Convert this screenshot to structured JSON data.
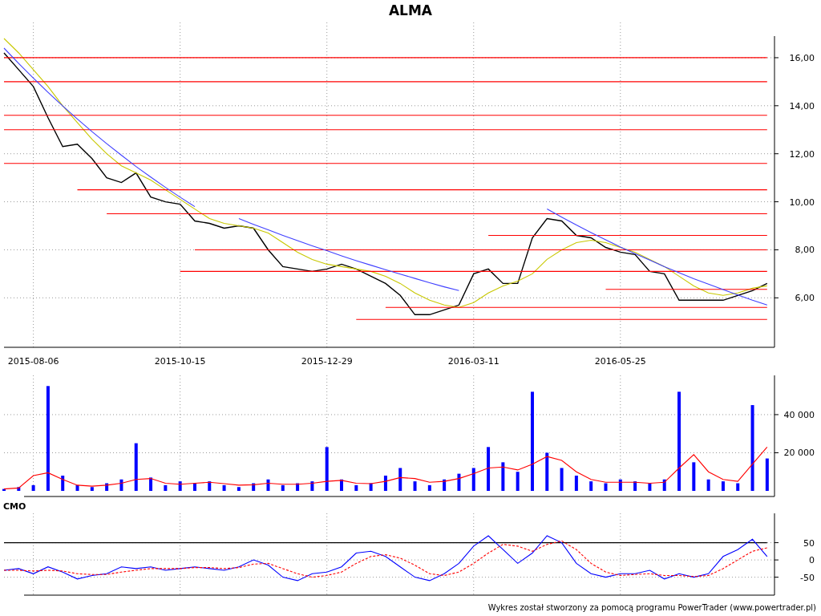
{
  "title": "ALMA",
  "price_panel": {
    "chart_data": {
      "type": "line",
      "grid": true,
      "categories": [
        null,
        null,
        "2015-08-06",
        null,
        null,
        null,
        null,
        null,
        null,
        null,
        null,
        null,
        "2015-10-15",
        null,
        null,
        null,
        null,
        null,
        null,
        null,
        null,
        null,
        "2015-12-29",
        null,
        null,
        null,
        null,
        null,
        null,
        null,
        null,
        null,
        "2016-03-11",
        null,
        null,
        null,
        null,
        null,
        null,
        null,
        null,
        null,
        "2016-05-25",
        null,
        null,
        null,
        null,
        null,
        null,
        null,
        null,
        null,
        null
      ],
      "series": [
        {
          "color": "#000000",
          "values": [
            16.2,
            15.5,
            14.8,
            13.5,
            12.3,
            12.4,
            11.8,
            11,
            10.8,
            11.2,
            10.2,
            10,
            9.9,
            9.2,
            9.1,
            8.9,
            9,
            8.9,
            8,
            7.3,
            7.2,
            7.1,
            7.2,
            7.4,
            7.2,
            6.9,
            6.6,
            6.1,
            5.3,
            5.3,
            5.5,
            5.7,
            7,
            7.2,
            6.6,
            6.6,
            8.5,
            9.3,
            9.2,
            8.6,
            8.5,
            8.1,
            7.9,
            7.8,
            7.1,
            7,
            5.9,
            5.9,
            5.9,
            5.9,
            6.1,
            6.3,
            6.6
          ]
        },
        {
          "color": "#c8c800",
          "values": [
            16.8,
            16.2,
            15.5,
            14.8,
            14,
            13.3,
            12.6,
            12,
            11.5,
            11.2,
            10.9,
            10.5,
            10.1,
            9.7,
            9.3,
            9.1,
            9,
            8.9,
            8.7,
            8.3,
            7.9,
            7.6,
            7.4,
            7.3,
            7.2,
            7.1,
            6.9,
            6.6,
            6.2,
            5.9,
            5.7,
            5.6,
            5.8,
            6.2,
            6.5,
            6.7,
            7,
            7.6,
            8,
            8.3,
            8.4,
            8.3,
            8.1,
            7.9,
            7.6,
            7.3,
            6.9,
            6.5,
            6.2,
            6.1,
            6.2,
            6.4,
            6.5
          ]
        },
        {
          "color": "#ff0000",
          "values": [
            16,
            16,
            16,
            16,
            16,
            16,
            16,
            16,
            16,
            16,
            16,
            16,
            16,
            16,
            16,
            16,
            16,
            16,
            16,
            16,
            16,
            16,
            16,
            16,
            16,
            16,
            16,
            16,
            16,
            16,
            16,
            16,
            16,
            16,
            16,
            16,
            16,
            16,
            16,
            16,
            16,
            16,
            16,
            16,
            16,
            16,
            16,
            16,
            16,
            16,
            16,
            16,
            16
          ]
        },
        {
          "color": "#ff0000",
          "values": [
            15,
            15,
            15,
            15,
            15,
            15,
            15,
            15,
            15,
            15,
            15,
            15,
            15,
            15,
            15,
            15,
            15,
            15,
            15,
            15,
            15,
            15,
            15,
            15,
            15,
            15,
            15,
            15,
            15,
            15,
            15,
            15,
            15,
            15,
            15,
            15,
            15,
            15,
            15,
            15,
            15,
            15,
            15,
            15,
            15,
            15,
            15,
            15,
            15,
            15,
            15,
            15,
            15
          ]
        },
        {
          "color": "#ff0000",
          "values": [
            13.6,
            13.6,
            13.6,
            13.6,
            13.6,
            13.6,
            13.6,
            13.6,
            13.6,
            13.6,
            13.6,
            13.6,
            13.6,
            13.6,
            13.6,
            13.6,
            13.6,
            13.6,
            13.6,
            13.6,
            13.6,
            13.6,
            13.6,
            13.6,
            13.6,
            13.6,
            13.6,
            13.6,
            13.6,
            13.6,
            13.6,
            13.6,
            13.6,
            13.6,
            13.6,
            13.6,
            13.6,
            13.6,
            13.6,
            13.6,
            13.6,
            13.6,
            13.6,
            13.6,
            13.6,
            13.6,
            13.6,
            13.6,
            13.6,
            13.6,
            13.6,
            13.6,
            13.6
          ]
        },
        {
          "color": "#ff0000",
          "values": [
            13,
            13,
            13,
            13,
            13,
            13,
            13,
            13,
            13,
            13,
            13,
            13,
            13,
            13,
            13,
            13,
            13,
            13,
            13,
            13,
            13,
            13,
            13,
            13,
            13,
            13,
            13,
            13,
            13,
            13,
            13,
            13,
            13,
            13,
            13,
            13,
            13,
            13,
            13,
            13,
            13,
            13,
            13,
            13,
            13,
            13,
            13,
            13,
            13,
            13,
            13,
            13,
            13
          ]
        },
        {
          "color": "#ff0000",
          "values": [
            11.6,
            11.6,
            11.6,
            11.6,
            11.6,
            11.6,
            11.6,
            11.6,
            11.6,
            11.6,
            11.6,
            11.6,
            11.6,
            11.6,
            11.6,
            11.6,
            11.6,
            11.6,
            11.6,
            11.6,
            11.6,
            11.6,
            11.6,
            11.6,
            11.6,
            11.6,
            11.6,
            11.6,
            11.6,
            11.6,
            11.6,
            11.6,
            11.6,
            11.6,
            11.6,
            11.6,
            11.6,
            11.6,
            11.6,
            11.6,
            11.6,
            11.6,
            11.6,
            11.6,
            11.6,
            11.6,
            11.6,
            11.6,
            11.6,
            11.6,
            11.6,
            11.6,
            11.6
          ]
        },
        {
          "color": "#ff0000",
          "values": [
            null,
            null,
            null,
            null,
            null,
            10.5,
            10.5,
            10.5,
            10.5,
            10.5,
            10.5,
            10.5,
            10.5,
            10.5,
            10.5,
            10.5,
            10.5,
            10.5,
            10.5,
            10.5,
            10.5,
            10.5,
            10.5,
            10.5,
            10.5,
            10.5,
            10.5,
            10.5,
            10.5,
            10.5,
            10.5,
            10.5,
            10.5,
            10.5,
            10.5,
            10.5,
            10.5,
            10.5,
            10.5,
            10.5,
            10.5,
            10.5,
            10.5,
            10.5,
            10.5,
            10.5,
            10.5,
            10.5,
            10.5,
            10.5,
            10.5,
            10.5,
            10.5
          ]
        },
        {
          "color": "#ff0000",
          "values": [
            null,
            null,
            null,
            null,
            null,
            null,
            null,
            9.5,
            9.5,
            9.5,
            9.5,
            9.5,
            9.5,
            9.5,
            9.5,
            9.5,
            9.5,
            9.5,
            9.5,
            9.5,
            9.5,
            9.5,
            9.5,
            9.5,
            9.5,
            9.5,
            9.5,
            9.5,
            9.5,
            9.5,
            9.5,
            9.5,
            9.5,
            9.5,
            9.5,
            9.5,
            9.5,
            9.5,
            9.5,
            9.5,
            9.5,
            9.5,
            9.5,
            9.5,
            9.5,
            9.5,
            9.5,
            9.5,
            9.5,
            9.5,
            9.5,
            9.5,
            9.5
          ]
        },
        {
          "color": "#ff0000",
          "values": [
            null,
            null,
            null,
            null,
            null,
            null,
            null,
            null,
            null,
            null,
            null,
            null,
            null,
            null,
            null,
            null,
            null,
            null,
            null,
            null,
            null,
            null,
            null,
            null,
            null,
            null,
            null,
            null,
            null,
            null,
            null,
            null,
            null,
            8.6,
            8.6,
            8.6,
            8.6,
            8.6,
            8.6,
            8.6,
            8.6,
            8.6,
            8.6,
            8.6,
            8.6,
            8.6,
            8.6,
            8.6,
            8.6,
            8.6,
            8.6,
            8.6,
            8.6
          ]
        },
        {
          "color": "#ff0000",
          "values": [
            null,
            null,
            null,
            null,
            null,
            null,
            null,
            null,
            null,
            null,
            null,
            null,
            null,
            8,
            8,
            8,
            8,
            8,
            8,
            8,
            8,
            8,
            8,
            8,
            8,
            8,
            8,
            8,
            8,
            8,
            8,
            8,
            8,
            8,
            8,
            8,
            8,
            8,
            8,
            8,
            8,
            8,
            8,
            8,
            8,
            8,
            8,
            8,
            8,
            8,
            8,
            8,
            8
          ]
        },
        {
          "color": "#ff0000",
          "values": [
            null,
            null,
            null,
            null,
            null,
            null,
            null,
            null,
            null,
            null,
            null,
            null,
            7.1,
            7.1,
            7.1,
            7.1,
            7.1,
            7.1,
            7.1,
            7.1,
            7.1,
            7.1,
            7.1,
            7.1,
            7.1,
            7.1,
            7.1,
            7.1,
            7.1,
            7.1,
            7.1,
            7.1,
            7.1,
            7.1,
            7.1,
            7.1,
            7.1,
            7.1,
            7.1,
            7.1,
            7.1,
            7.1,
            7.1,
            7.1,
            7.1,
            7.1,
            7.1,
            7.1,
            7.1,
            7.1,
            7.1,
            7.1,
            7.1
          ]
        },
        {
          "color": "#ff0000",
          "values": [
            null,
            null,
            null,
            null,
            null,
            null,
            null,
            null,
            null,
            null,
            null,
            null,
            null,
            null,
            null,
            null,
            null,
            null,
            null,
            null,
            null,
            null,
            null,
            null,
            null,
            null,
            null,
            null,
            null,
            null,
            null,
            null,
            null,
            null,
            null,
            null,
            null,
            null,
            null,
            null,
            null,
            6.35,
            6.35,
            6.35,
            6.35,
            6.35,
            6.35,
            6.35,
            6.35,
            6.35,
            6.35,
            6.35,
            6.35
          ]
        },
        {
          "color": "#ff0000",
          "values": [
            null,
            null,
            null,
            null,
            null,
            null,
            null,
            null,
            null,
            null,
            null,
            null,
            null,
            null,
            null,
            null,
            null,
            null,
            null,
            null,
            null,
            null,
            null,
            null,
            null,
            null,
            5.6,
            5.6,
            5.6,
            5.6,
            5.6,
            5.6,
            5.6,
            5.6,
            5.6,
            5.6,
            5.6,
            5.6,
            5.6,
            5.6,
            5.6,
            5.6,
            5.6,
            5.6,
            5.6,
            5.6,
            5.6,
            5.6,
            5.6,
            5.6,
            5.6,
            5.6,
            5.6
          ]
        },
        {
          "color": "#ff0000",
          "values": [
            null,
            null,
            null,
            null,
            null,
            null,
            null,
            null,
            null,
            null,
            null,
            null,
            null,
            null,
            null,
            null,
            null,
            null,
            null,
            null,
            null,
            null,
            null,
            null,
            5.1,
            5.1,
            5.1,
            5.1,
            5.1,
            5.1,
            5.1,
            5.1,
            5.1,
            5.1,
            5.1,
            5.1,
            5.1,
            5.1,
            5.1,
            5.1,
            5.1,
            5.1,
            5.1,
            5.1,
            5.1,
            5.1,
            5.1,
            5.1,
            5.1,
            5.1,
            5.1,
            5.1,
            5.1
          ]
        },
        {
          "color": "#4040ff",
          "values": [
            16.4,
            15.76,
            15.15,
            14.56,
            13.99,
            13.45,
            12.92,
            12.42,
            11.94,
            11.47,
            11.03,
            10.6,
            10.19,
            9.8,
            null,
            null,
            null,
            null,
            null,
            null,
            null,
            null,
            null,
            null,
            null,
            null,
            null,
            null,
            null,
            null,
            null,
            null,
            null,
            null,
            null,
            null,
            null,
            null,
            null,
            null,
            null,
            null,
            null,
            null,
            null,
            null,
            null,
            null,
            null,
            null,
            null,
            null,
            null
          ]
        },
        {
          "color": "#4040ff",
          "values": [
            null,
            null,
            null,
            null,
            null,
            null,
            null,
            null,
            null,
            null,
            null,
            null,
            null,
            null,
            null,
            null,
            9.3,
            9.06,
            8.83,
            8.6,
            8.38,
            8.17,
            7.96,
            7.75,
            7.55,
            7.36,
            7.17,
            6.99,
            6.81,
            6.63,
            6.46,
            6.3,
            null,
            null,
            null,
            null,
            null,
            null,
            null,
            null,
            null,
            null,
            null,
            null,
            null,
            null,
            null,
            null,
            null,
            null,
            null,
            null,
            null
          ]
        },
        {
          "color": "#4040ff",
          "values": [
            null,
            null,
            null,
            null,
            null,
            null,
            null,
            null,
            null,
            null,
            null,
            null,
            null,
            null,
            null,
            null,
            null,
            null,
            null,
            null,
            null,
            null,
            null,
            null,
            null,
            null,
            null,
            null,
            null,
            null,
            null,
            null,
            null,
            null,
            null,
            null,
            null,
            9.7,
            9.36,
            9.03,
            8.72,
            8.42,
            8.12,
            7.84,
            7.57,
            7.3,
            7.05,
            6.8,
            6.57,
            6.34,
            6.12,
            5.9,
            5.7
          ]
        }
      ],
      "ylim": [
        3.94,
        16.9
      ],
      "yticks": [
        {
          "value": 16,
          "label": "16,00"
        },
        {
          "value": 14,
          "label": "14,00"
        },
        {
          "value": 12,
          "label": "12,00"
        },
        {
          "value": 10,
          "label": "10,00"
        },
        {
          "value": 8,
          "label": "8,00"
        },
        {
          "value": 6,
          "label": "6,00"
        }
      ]
    }
  },
  "volume_panel": {
    "chart_data": {
      "type": "bar",
      "grid": true,
      "categories": [
        null,
        null,
        null,
        null,
        null,
        null,
        null,
        null,
        null,
        null,
        null,
        null,
        null,
        null,
        null,
        null,
        null,
        null,
        null,
        null,
        null,
        null,
        null,
        null,
        null,
        null,
        null,
        null,
        null,
        null,
        null,
        null,
        null,
        null,
        null,
        null,
        null,
        null,
        null,
        null,
        null,
        null,
        null,
        null,
        null,
        null,
        null,
        null,
        null,
        null,
        null,
        null,
        null
      ],
      "series": [
        {
          "color": "#0000ff",
          "values": [
            1000,
            2000,
            3000,
            55000,
            8000,
            3000,
            2000,
            4000,
            6000,
            25000,
            7000,
            3000,
            5000,
            4000,
            5000,
            3000,
            2000,
            4000,
            6000,
            3000,
            4000,
            5000,
            23000,
            6000,
            3000,
            4000,
            8000,
            12000,
            5000,
            3000,
            6000,
            9000,
            12000,
            23000,
            15000,
            10000,
            52000,
            20000,
            12000,
            8000,
            5000,
            4000,
            6000,
            5000,
            4000,
            6000,
            52000,
            15000,
            6000,
            5000,
            4000,
            45000,
            17000
          ]
        },
        {
          "type": "line",
          "color": "#ff0000",
          "values": [
            1000,
            1500,
            8000,
            9500,
            6000,
            3000,
            2500,
            3000,
            4000,
            6000,
            6500,
            4000,
            3500,
            4000,
            4500,
            3800,
            3000,
            3200,
            4000,
            3500,
            3500,
            4000,
            5000,
            5500,
            4000,
            3800,
            5000,
            7000,
            6500,
            4500,
            5000,
            6500,
            9000,
            12000,
            12500,
            11000,
            14000,
            18000,
            16000,
            10000,
            6000,
            4500,
            4500,
            4500,
            4000,
            4500,
            12000,
            19000,
            10000,
            6000,
            5000,
            14000,
            23000
          ]
        }
      ],
      "ylim": [
        0,
        60600
      ],
      "yticks": [
        {
          "value": 20000,
          "label": "20 000"
        },
        {
          "value": 40000,
          "label": "40 000"
        }
      ]
    }
  },
  "cmo_panel": {
    "label": "CMO",
    "chart_data": {
      "type": "line",
      "grid": true,
      "categories": [
        null,
        null,
        null,
        null,
        null,
        null,
        null,
        null,
        null,
        null,
        null,
        null,
        null,
        null,
        null,
        null,
        null,
        null,
        null,
        null,
        null,
        null,
        null,
        null,
        null,
        null,
        null,
        null,
        null,
        null,
        null,
        null,
        null,
        null,
        null,
        null,
        null,
        null,
        null,
        null,
        null,
        null,
        null,
        null,
        null,
        null,
        null,
        null,
        null,
        null,
        null,
        null,
        null
      ],
      "series": [
        {
          "color": "#000000",
          "values": [
            50,
            50,
            50,
            50,
            50,
            50,
            50,
            50,
            50,
            50,
            50,
            50,
            50,
            50,
            50,
            50,
            50,
            50,
            50,
            50,
            50,
            50,
            50,
            50,
            50,
            50,
            50,
            50,
            50,
            50,
            50,
            50,
            50,
            50,
            50,
            50,
            50,
            50,
            50,
            50,
            50,
            50,
            50,
            50,
            50,
            50,
            50,
            50,
            50,
            50,
            50,
            50,
            50
          ]
        },
        {
          "color": "#0000ff",
          "values": [
            -30,
            -25,
            -40,
            -20,
            -35,
            -55,
            -45,
            -40,
            -20,
            -25,
            -20,
            -30,
            -25,
            -20,
            -25,
            -30,
            -20,
            0,
            -15,
            -50,
            -60,
            -40,
            -35,
            -20,
            20,
            25,
            10,
            -20,
            -50,
            -60,
            -40,
            -10,
            40,
            70,
            30,
            -10,
            20,
            70,
            50,
            -10,
            -40,
            -50,
            -40,
            -40,
            -30,
            -55,
            -40,
            -50,
            -40,
            10,
            30,
            60,
            10
          ]
        },
        {
          "color": "#ff0000",
          "line_style": "dashed",
          "values": [
            -30,
            -30,
            -32,
            -30,
            -32,
            -40,
            -42,
            -42,
            -35,
            -30,
            -25,
            -25,
            -25,
            -22,
            -22,
            -25,
            -22,
            -12,
            -10,
            -25,
            -40,
            -50,
            -45,
            -35,
            -10,
            10,
            15,
            5,
            -15,
            -40,
            -45,
            -35,
            -10,
            20,
            45,
            40,
            25,
            45,
            55,
            30,
            -10,
            -35,
            -45,
            -42,
            -40,
            -45,
            -45,
            -48,
            -45,
            -25,
            0,
            25,
            35
          ]
        }
      ],
      "ylim": [
        -102,
        135
      ],
      "yticks": [
        {
          "value": 50,
          "label": "50"
        },
        {
          "value": 0,
          "label": "0"
        },
        {
          "value": -50,
          "label": "-50"
        }
      ]
    }
  },
  "footer": "Wykres został stworzony za pomocą programu PowerTrader (www.powertrader.pl)"
}
